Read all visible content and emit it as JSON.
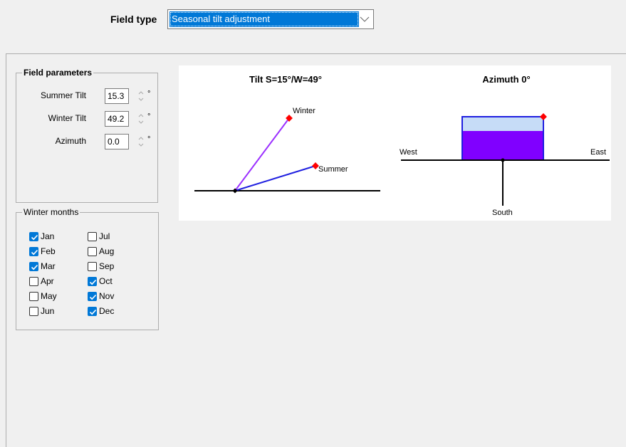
{
  "header": {
    "field_type_label": "Field type",
    "field_type_value": "Seasonal tilt adjustment"
  },
  "field_parameters": {
    "legend": "Field parameters",
    "summer_tilt": {
      "label": "Summer Tilt",
      "value": "15.3",
      "unit": "°"
    },
    "winter_tilt": {
      "label": "Winter Tilt",
      "value": "49.2",
      "unit": "°"
    },
    "azimuth": {
      "label": "Azimuth",
      "value": "0.0",
      "unit": "°"
    }
  },
  "winter_months": {
    "legend": "Winter months",
    "months": [
      {
        "label": "Jan",
        "checked": true
      },
      {
        "label": "Feb",
        "checked": true
      },
      {
        "label": "Mar",
        "checked": true
      },
      {
        "label": "Apr",
        "checked": false
      },
      {
        "label": "May",
        "checked": false
      },
      {
        "label": "Jun",
        "checked": false
      },
      {
        "label": "Jul",
        "checked": false
      },
      {
        "label": "Aug",
        "checked": false
      },
      {
        "label": "Sep",
        "checked": false
      },
      {
        "label": "Oct",
        "checked": true
      },
      {
        "label": "Nov",
        "checked": true
      },
      {
        "label": "Dec",
        "checked": true
      }
    ]
  },
  "diagram": {
    "tilt_title": "Tilt S=15°/W=49°",
    "winter_label": "Winter",
    "summer_label": "Summer",
    "azimuth_title": "Azimuth 0°",
    "west_label": "West",
    "east_label": "East",
    "south_label": "South"
  },
  "colors": {
    "accent": "#0078d7",
    "winter_line": "#9b30ff",
    "summer_line": "#1f1fe0",
    "azimuth_fill": "#8000ff",
    "azimuth_light": "#c6dcf7",
    "marker": "#ff0000"
  }
}
